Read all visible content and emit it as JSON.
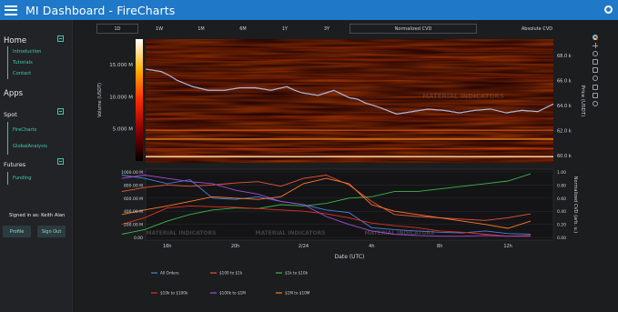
{
  "header": {
    "title": "MI Dashboard  -  FireCharts"
  },
  "sidebar": {
    "home": {
      "label": "Home",
      "items": [
        "Introduction",
        "Tutorials",
        "Contact"
      ]
    },
    "apps_label": "Apps",
    "spot": {
      "label": "Spot",
      "items": [
        "FireCharts",
        "GlobalAnalysis"
      ]
    },
    "futures": {
      "label": "Futures",
      "items": [
        "Funding"
      ]
    },
    "signed_in": "Signed in as: Keith Alan",
    "profile": "Profile",
    "signout": "Sign Out"
  },
  "toolbar": {
    "ranges": [
      "1D",
      "1W",
      "1M",
      "6M",
      "1Y",
      "3Y"
    ],
    "active_range": "1D",
    "normalized_cvd": "Normalized CVD",
    "absolute_cvd": "Absolute CVD"
  },
  "watermark": "MATERIAL INDICATORS",
  "colors": {
    "header": "#1f78c8",
    "accent": "#3fc7b0",
    "background": "#1c1d1f"
  },
  "chart_data": [
    {
      "type": "heatmap",
      "colorbar": {
        "label": "Volume (USDT)",
        "ticks": [
          "15.000 M",
          "10.000 M",
          "5.000 M"
        ],
        "tick_values": [
          15,
          10,
          5
        ],
        "range": [
          0,
          19
        ],
        "colors": [
          "#000000",
          "#8b0000",
          "#ff2a00",
          "#ffb000",
          "#ffffff"
        ]
      },
      "ylabel": "Price (USDT)",
      "y_ticks": [
        "68.0 k",
        "66.0 k",
        "64.0 k",
        "62.0 k",
        "60.0 k"
      ],
      "y_tick_values": [
        68,
        66,
        64,
        62,
        60
      ],
      "ylim": [
        59.4,
        69.3
      ],
      "price_line": {
        "t": [
          0,
          2,
          3,
          4,
          6,
          8,
          10,
          12,
          14,
          16,
          18,
          19,
          20,
          22,
          24,
          26,
          27,
          28,
          30,
          32,
          34,
          36,
          38,
          40,
          42,
          44,
          46,
          48,
          50,
          52
        ],
        "price": [
          66.9,
          66.7,
          66.4,
          66.0,
          65.5,
          65.2,
          65.2,
          65.4,
          65.4,
          65.2,
          65.5,
          65.2,
          65.0,
          64.8,
          65.2,
          64.6,
          64.5,
          64.2,
          63.8,
          63.3,
          63.5,
          63.7,
          63.6,
          63.4,
          63.6,
          63.7,
          63.4,
          63.6,
          63.5,
          64.1
        ]
      }
    },
    {
      "type": "line",
      "xlabel": "Date (UTC)",
      "x_ticks": [
        "16h",
        "20h",
        "2/24",
        "4h",
        "8h",
        "12h"
      ],
      "x_tick_values": [
        4,
        10,
        16,
        22,
        28,
        34
      ],
      "xlim": [
        2.1,
        38
      ],
      "ylabel_left": "",
      "y_left_ticks": [
        "1000.00 M",
        "800.00 M",
        "600.00 M",
        "400.00 M",
        "200.00 M",
        "0.00"
      ],
      "y_left_tick_values": [
        1000,
        800,
        600,
        400,
        200,
        0
      ],
      "ylim_left": [
        -40,
        1040
      ],
      "ylabel_right": "Normalized CVD (arb. u.)",
      "y_right_ticks": [
        "1.00",
        "0.80",
        "0.60",
        "0.40",
        "0.20",
        "0.00"
      ],
      "y_right_tick_values": [
        1,
        0.8,
        0.6,
        0.4,
        0.2,
        0
      ],
      "ylim_right": [
        -0.04,
        1.04
      ],
      "legend": "bottom",
      "x": [
        0,
        2,
        4,
        6,
        8,
        10,
        12,
        14,
        16,
        18,
        20,
        22,
        24,
        26,
        28,
        30,
        32,
        34,
        36
      ],
      "series": [
        {
          "name": "All Orders",
          "color": "#4a7fd6",
          "values": [
            0.95,
            0.9,
            0.82,
            0.88,
            0.6,
            0.58,
            0.62,
            0.55,
            0.5,
            0.42,
            0.38,
            0.15,
            0.12,
            0.1,
            0.08,
            0.07,
            0.1,
            0.06,
            0.05
          ]
        },
        {
          "name": "$100 to $1k",
          "color": "#e8533a",
          "values": [
            0.7,
            0.76,
            0.8,
            0.78,
            0.8,
            0.83,
            0.85,
            0.78,
            0.9,
            0.95,
            0.8,
            0.55,
            0.35,
            0.32,
            0.3,
            0.28,
            0.26,
            0.3,
            0.36
          ]
        },
        {
          "name": "$1k to $10k",
          "color": "#3bb54a",
          "values": [
            0.05,
            0.12,
            0.25,
            0.35,
            0.42,
            0.45,
            0.44,
            0.5,
            0.48,
            0.52,
            0.6,
            0.62,
            0.7,
            0.7,
            0.74,
            0.78,
            0.82,
            0.86,
            0.97
          ]
        },
        {
          "name": "$10k to $100k",
          "color": "#e0301e",
          "values": [
            0.2,
            0.3,
            0.45,
            0.48,
            0.47,
            0.46,
            0.44,
            0.42,
            0.4,
            0.36,
            0.3,
            0.22,
            0.18,
            0.15,
            0.1,
            0.08,
            0.05,
            0.02,
            0.03
          ]
        },
        {
          "name": "$100k to $1M",
          "color": "#a64bd8",
          "values": [
            0.9,
            0.95,
            0.9,
            0.85,
            0.82,
            0.72,
            0.66,
            0.55,
            0.5,
            0.32,
            0.2,
            0.1,
            0.05,
            0.03,
            0.02,
            0.02,
            0.03,
            0.02,
            0.02
          ]
        },
        {
          "name": "$1M to $10M",
          "color": "#ff7a2e",
          "values": [
            0.35,
            0.42,
            0.48,
            0.55,
            0.62,
            0.6,
            0.58,
            0.62,
            0.82,
            0.9,
            0.82,
            0.5,
            0.4,
            0.35,
            0.3,
            0.25,
            0.2,
            0.14,
            0.25
          ]
        }
      ]
    }
  ]
}
